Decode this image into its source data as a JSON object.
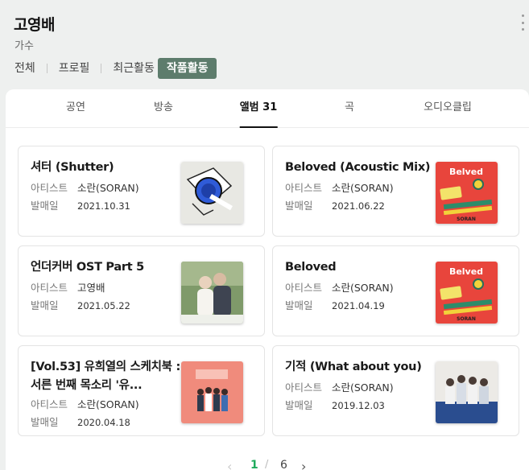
{
  "artist": {
    "name": "고영배",
    "role": "가수"
  },
  "main_tabs": [
    "전체",
    "프로필",
    "최근활동",
    "작품활동"
  ],
  "sub_tabs": [
    "공연",
    "방송",
    "앨범 31",
    "곡",
    "오디오클립"
  ],
  "labels": {
    "artist": "아티스트",
    "release": "발매일"
  },
  "albums": [
    {
      "title": "셔터 (Shutter)",
      "artist": "소란(SORAN)",
      "date": "2021.10.31"
    },
    {
      "title": "Beloved (Acoustic Mix)",
      "artist": "소란(SORAN)",
      "date": "2021.06.22"
    },
    {
      "title": "언더커버 OST Part 5",
      "artist": "고영배",
      "date": "2021.05.22"
    },
    {
      "title": "Beloved",
      "artist": "소란(SORAN)",
      "date": "2021.04.19"
    },
    {
      "title": "[Vol.53] 유희열의 스케치북 : 서른 번째 목소리 '유...",
      "artist": "소란(SORAN)",
      "date": "2020.04.18"
    },
    {
      "title": "기적 (What about you)",
      "artist": "소란(SORAN)",
      "date": "2019.12.03"
    }
  ],
  "pagination": {
    "current": "1",
    "slash": "/",
    "total": "6",
    "prev": "‹",
    "next": "›"
  },
  "colors": {
    "active_tab_bg": "#5d7c6c",
    "page_current": "#1fab5c"
  }
}
